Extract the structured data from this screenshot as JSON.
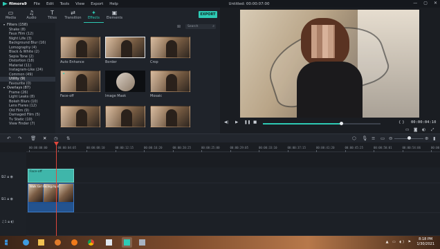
{
  "app": {
    "logo": "filmora9",
    "title": "Untitled:",
    "time": "00:00:07:00"
  },
  "menu": [
    "File",
    "Edit",
    "Tools",
    "View",
    "Export",
    "Help"
  ],
  "window_buttons": [
    "—",
    "▢",
    "✕"
  ],
  "media_tabs": [
    {
      "label": "Media",
      "icon": "folder-icon"
    },
    {
      "label": "Audio",
      "icon": "music-icon"
    },
    {
      "label": "Titles",
      "icon": "text-icon"
    },
    {
      "label": "Transition",
      "icon": "transition-icon"
    },
    {
      "label": "Effects",
      "icon": "effects-icon",
      "active": true
    },
    {
      "label": "Elements",
      "icon": "elements-icon"
    }
  ],
  "export_label": "EXPORT",
  "categories": [
    {
      "label": "Filters (158)",
      "type": "group"
    },
    {
      "label": "Shake (8)",
      "type": "item"
    },
    {
      "label": "Faux Film (12)",
      "type": "item"
    },
    {
      "label": "Night Life (3)",
      "type": "item"
    },
    {
      "label": "Background Blur (16)",
      "type": "item"
    },
    {
      "label": "Lomography (4)",
      "type": "item"
    },
    {
      "label": "Black & White (2)",
      "type": "item"
    },
    {
      "label": "Sepia Tone (2)",
      "type": "item"
    },
    {
      "label": "Distortion (18)",
      "type": "item"
    },
    {
      "label": "Material (11)",
      "type": "item"
    },
    {
      "label": "Instagram-Like (24)",
      "type": "item"
    },
    {
      "label": "Common (49)",
      "type": "item"
    },
    {
      "label": "Utility (9)",
      "type": "item",
      "selected": true
    },
    {
      "label": "Favourite (0)",
      "type": "item"
    },
    {
      "label": "Overlays (87)",
      "type": "group"
    },
    {
      "label": "Frame (26)",
      "type": "item"
    },
    {
      "label": "Light Leaks (8)",
      "type": "item"
    },
    {
      "label": "Bokeh Blurs (10)",
      "type": "item"
    },
    {
      "label": "Lens Flares (12)",
      "type": "item"
    },
    {
      "label": "Old Film (9)",
      "type": "item"
    },
    {
      "label": "Damaged Film (5)",
      "type": "item"
    },
    {
      "label": "Tv Static (10)",
      "type": "item"
    },
    {
      "label": "View Finder (7)",
      "type": "item"
    }
  ],
  "search_placeholder": "Search",
  "effects": [
    {
      "label": "Auto Enhance",
      "style": "photo"
    },
    {
      "label": "Border",
      "style": "photo",
      "selected": true
    },
    {
      "label": "Crop",
      "style": "photo"
    },
    {
      "label": "Face-off",
      "style": "photo"
    },
    {
      "label": "Image Mask",
      "style": "circle"
    },
    {
      "label": "Mosaic",
      "style": "photo"
    },
    {
      "label": "",
      "style": "photo"
    },
    {
      "label": "",
      "style": "photo"
    },
    {
      "label": "",
      "style": "photo"
    }
  ],
  "preview": {
    "timecode": "00:00:04:10",
    "progress": 0.67
  },
  "ruler_labels": [
    "00:00:00:00",
    "00:00:04:05",
    "00:00:08:10",
    "00:00:12:15",
    "00:00:16:20",
    "00:00:20:25",
    "00:00:25:00",
    "00:00:29:05",
    "00:00:33:10",
    "00:00:37:15",
    "00:00:41:20",
    "00:00:45:25",
    "00:00:50:01",
    "00:00:54:06",
    "00:00:58:11"
  ],
  "tracks": [
    {
      "label": "2",
      "clip": "Face-off"
    },
    {
      "label": "1",
      "clip": "Walk Girl Facing.mp4"
    },
    {
      "label": "1"
    }
  ],
  "zoom_level": 0.5,
  "taskbar": {
    "time": "8:18 PM",
    "date": "1/30/2021"
  },
  "colors": {
    "accent": "#2dcbb5",
    "playhead": "#e0473c",
    "video_clip": "#1e4f8f",
    "fx_clip": "#3fb6aa"
  }
}
